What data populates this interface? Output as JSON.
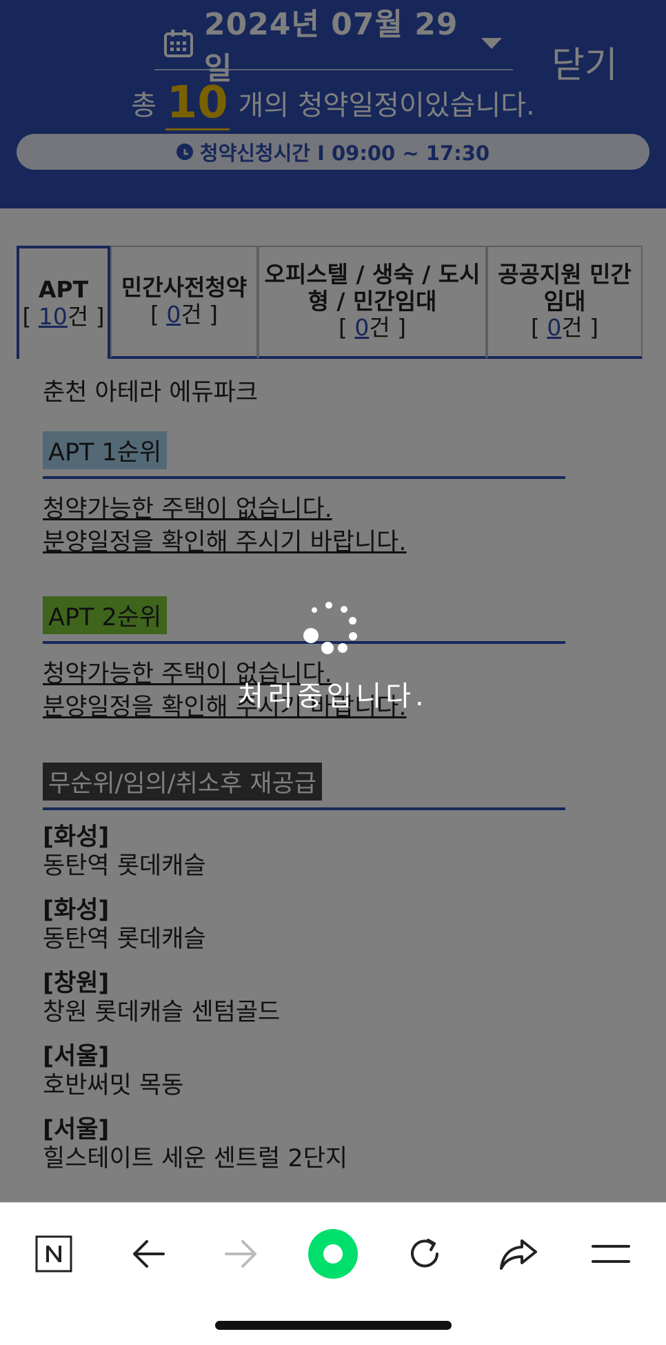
{
  "header": {
    "date": "2024년 07월 29일",
    "close_label": "닫기",
    "summary_prefix": "총",
    "summary_count": "10",
    "summary_suffix": "개의 청약일정이있습니다.",
    "hours": "청약신청시간 I 09:00 ~ 17:30"
  },
  "tabs": [
    {
      "title": "APT",
      "count": "10",
      "active": true
    },
    {
      "title": "민간사전청약",
      "count": "0",
      "active": false
    },
    {
      "title": "오피스텔 / 생숙 / 도시형 / 민간임대",
      "count": "0",
      "active": false
    },
    {
      "title": "공공지원 민간임대",
      "count": "0",
      "active": false
    }
  ],
  "tab_count_open": "[",
  "tab_count_unit": "건 ]",
  "content": {
    "site_name": "춘천 아테라 에듀파크",
    "rank1_label": "APT 1순위",
    "rank1_notice_1": "청약가능한 주택이 없습니다.",
    "rank1_notice_2": "분양일정을 확인해 주시기 바랍니다.",
    "rank2_label": "APT 2순위",
    "rank2_notice_1": "청약가능한 주택이 없습니다.",
    "rank2_notice_2": "분양일정을 확인해 주시기 바랍니다.",
    "rank3_label": "무순위/임의/취소후 재공급",
    "entries": [
      {
        "region": "[화성]",
        "name": "동탄역 롯데캐슬"
      },
      {
        "region": "[화성]",
        "name": "동탄역 롯데캐슬"
      },
      {
        "region": "[창원]",
        "name": "창원 롯데캐슬 센텀골드"
      },
      {
        "region": "[서울]",
        "name": "호반써밋 목동"
      },
      {
        "region": "[서울]",
        "name": "힐스테이트 세운 센트럴 2단지"
      }
    ]
  },
  "overlay": {
    "loading_text": "처리중입니다."
  },
  "toolbar": {
    "icons": [
      "naver-n-icon",
      "back-arrow-icon",
      "forward-arrow-icon",
      "green-home-icon",
      "reload-icon",
      "share-icon",
      "menu-icon"
    ]
  },
  "colors": {
    "brand_blue": "#2f4eb4",
    "highlight_yellow": "#f2c200",
    "rank1_bg": "#a6d3ec",
    "rank2_bg": "#7fcb3b",
    "rank3_bg": "#444444",
    "green_button": "#00de6c"
  }
}
